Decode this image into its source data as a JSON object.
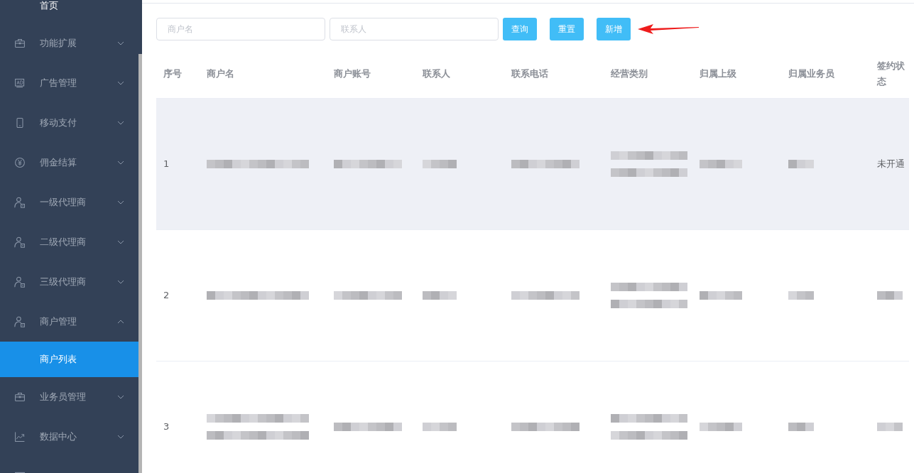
{
  "sidebar": {
    "top_item": "首页",
    "items": [
      {
        "label": "功能扩展",
        "expanded": false
      },
      {
        "label": "广告管理",
        "expanded": false
      },
      {
        "label": "移动支付",
        "expanded": false
      },
      {
        "label": "佣金结算",
        "expanded": false
      },
      {
        "label": "一级代理商",
        "expanded": false
      },
      {
        "label": "二级代理商",
        "expanded": false
      },
      {
        "label": "三级代理商",
        "expanded": false
      },
      {
        "label": "商户管理",
        "expanded": true,
        "children": [
          {
            "label": "商户列表",
            "selected": true
          }
        ]
      },
      {
        "label": "业务员管理",
        "expanded": false
      },
      {
        "label": "数据中心",
        "expanded": false
      }
    ]
  },
  "filters": {
    "fields": [
      {
        "placeholder": "商户名"
      },
      {
        "placeholder": "联系人"
      }
    ],
    "buttons": [
      "查询",
      "重置",
      "新增"
    ]
  },
  "table": {
    "columns": [
      "序号",
      "商户名",
      "商户账号",
      "联系人",
      "联系电话",
      "经营类别",
      "归属上级",
      "归属业务员",
      "签约状态"
    ],
    "rows": [
      {
        "selected": true,
        "cells": [
          {
            "kind": "text",
            "text": "1"
          },
          {
            "kind": "redacted"
          },
          {
            "kind": "redacted"
          },
          {
            "kind": "redacted"
          },
          {
            "kind": "redacted"
          },
          {
            "kind": "redacted"
          },
          {
            "kind": "redacted"
          },
          {
            "kind": "redacted"
          },
          {
            "kind": "text",
            "text": "未开通"
          }
        ]
      },
      {
        "selected": false,
        "cells": [
          {
            "kind": "text",
            "text": "2"
          },
          {
            "kind": "redacted"
          },
          {
            "kind": "redacted"
          },
          {
            "kind": "redacted"
          },
          {
            "kind": "redacted"
          },
          {
            "kind": "redacted"
          },
          {
            "kind": "redacted"
          },
          {
            "kind": "redacted"
          },
          {
            "kind": "redacted"
          }
        ]
      },
      {
        "selected": false,
        "cells": [
          {
            "kind": "text",
            "text": "3"
          },
          {
            "kind": "redacted"
          },
          {
            "kind": "redacted"
          },
          {
            "kind": "redacted"
          },
          {
            "kind": "redacted"
          },
          {
            "kind": "redacted"
          },
          {
            "kind": "redacted"
          },
          {
            "kind": "redacted"
          },
          {
            "kind": "redacted"
          }
        ]
      }
    ]
  }
}
